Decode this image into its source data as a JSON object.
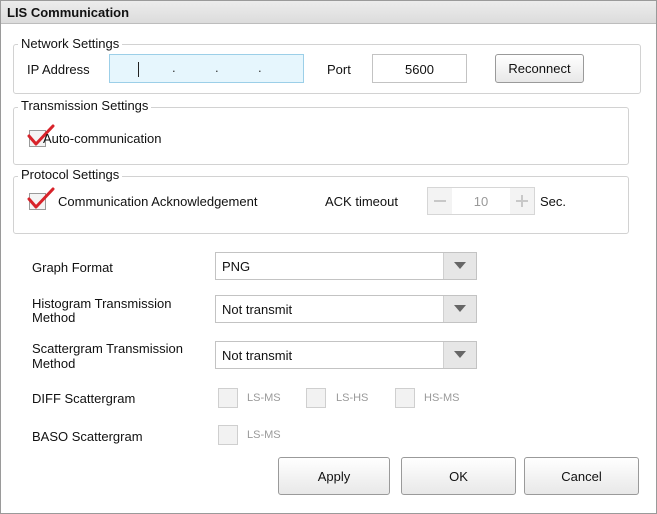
{
  "window": {
    "title": "LIS Communication"
  },
  "network": {
    "group_title": "Network Settings",
    "ip_label": "IP Address",
    "ip_dots": [
      ".",
      ".",
      "."
    ],
    "port_label": "Port",
    "port_value": "5600",
    "reconnect_label": "Reconnect"
  },
  "transmission": {
    "group_title": "Transmission  Settings",
    "auto_label": "Auto-communication",
    "auto_checked": true
  },
  "protocol": {
    "group_title": "Protocol Settings",
    "ack_label": "Communication Acknowledgement",
    "ack_checked": true,
    "timeout_label": "ACK timeout",
    "timeout_value": "10",
    "timeout_unit": "Sec."
  },
  "graph": {
    "format_label": "Graph Format",
    "format_value": "PNG",
    "histogram_label_line1": "Histogram Transmission",
    "histogram_label_line2": "Method",
    "histogram_value": "Not transmit",
    "scattergram_label_line1": "Scattergram Transmission",
    "scattergram_label_line2": "Method",
    "scattergram_value": "Not transmit",
    "diff_label": "DIFF Scattergram",
    "diff_options": [
      "LS-MS",
      "LS-HS",
      "HS-MS"
    ],
    "baso_label": "BASO Scattergram",
    "baso_options": [
      "LS-MS"
    ]
  },
  "buttons": {
    "apply": "Apply",
    "ok": "OK",
    "cancel": "Cancel"
  },
  "colors": {
    "checkmark": "#d8232a",
    "ip_field_bg": "#e6f6fd"
  }
}
